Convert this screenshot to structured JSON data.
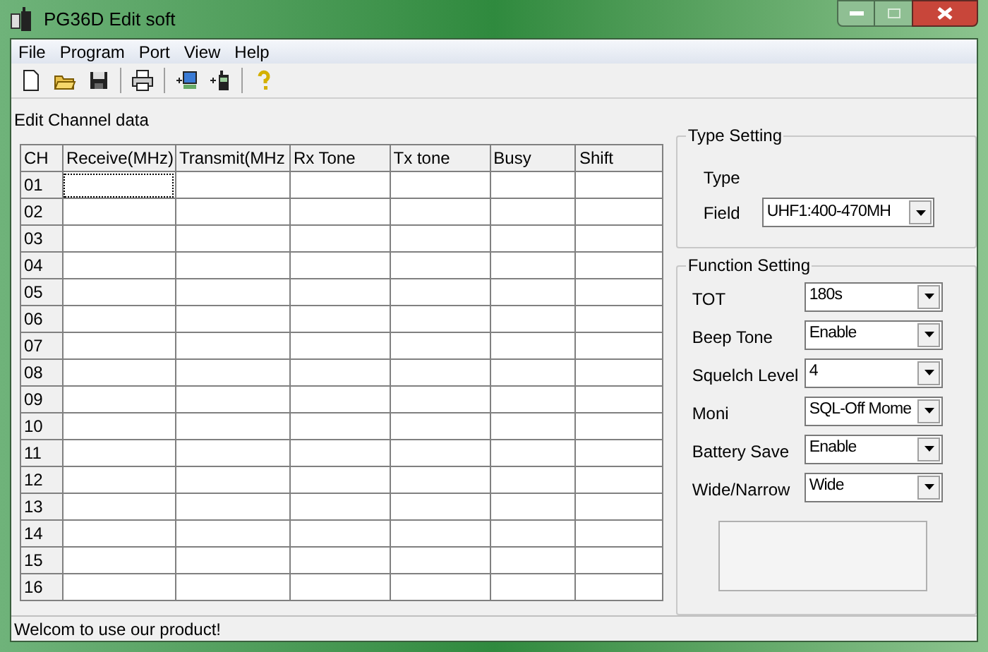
{
  "window": {
    "title": "PG36D Edit soft"
  },
  "menu": [
    "File",
    "Program",
    "Port",
    "View",
    "Help"
  ],
  "toolbar": [
    {
      "kind": "new"
    },
    {
      "kind": "open"
    },
    {
      "kind": "save"
    },
    {
      "kind": "sep"
    },
    {
      "kind": "print"
    },
    {
      "kind": "sep"
    },
    {
      "kind": "read"
    },
    {
      "kind": "write"
    },
    {
      "kind": "sep"
    },
    {
      "kind": "help"
    }
  ],
  "section_label": "Edit Channel data",
  "table": {
    "columns": [
      "CH",
      "Receive(MHz)",
      "Transmit(MHz",
      "Rx Tone",
      "Tx tone",
      "Busy",
      "Shift"
    ],
    "rows": [
      {
        "ch": "01",
        "focused": true
      },
      {
        "ch": "02",
        "focused": false
      },
      {
        "ch": "03",
        "focused": false
      },
      {
        "ch": "04",
        "focused": false
      },
      {
        "ch": "05",
        "focused": false
      },
      {
        "ch": "06",
        "focused": false
      },
      {
        "ch": "07",
        "focused": false
      },
      {
        "ch": "08",
        "focused": false
      },
      {
        "ch": "09",
        "focused": false
      },
      {
        "ch": "10",
        "focused": false
      },
      {
        "ch": "11",
        "focused": false
      },
      {
        "ch": "12",
        "focused": false
      },
      {
        "ch": "13",
        "focused": false
      },
      {
        "ch": "14",
        "focused": false
      },
      {
        "ch": "15",
        "focused": false
      },
      {
        "ch": "16",
        "focused": false
      }
    ]
  },
  "type_setting": {
    "title": "Type Setting",
    "type_label": "Type",
    "field_label": "Field",
    "field_value": "UHF1:400-470MH"
  },
  "function_setting": {
    "title": "Function Setting",
    "items": [
      {
        "label": "TOT",
        "value": "180s"
      },
      {
        "label": "Beep Tone",
        "value": "Enable"
      },
      {
        "label": "Squelch Level",
        "value": "4"
      },
      {
        "label": "Moni",
        "value": "SQL-Off Mome"
      },
      {
        "label": "Battery Save",
        "value": "Enable"
      },
      {
        "label": "Wide/Narrow",
        "value": "Wide"
      }
    ]
  },
  "status_bar": "Welcom to use our product!"
}
